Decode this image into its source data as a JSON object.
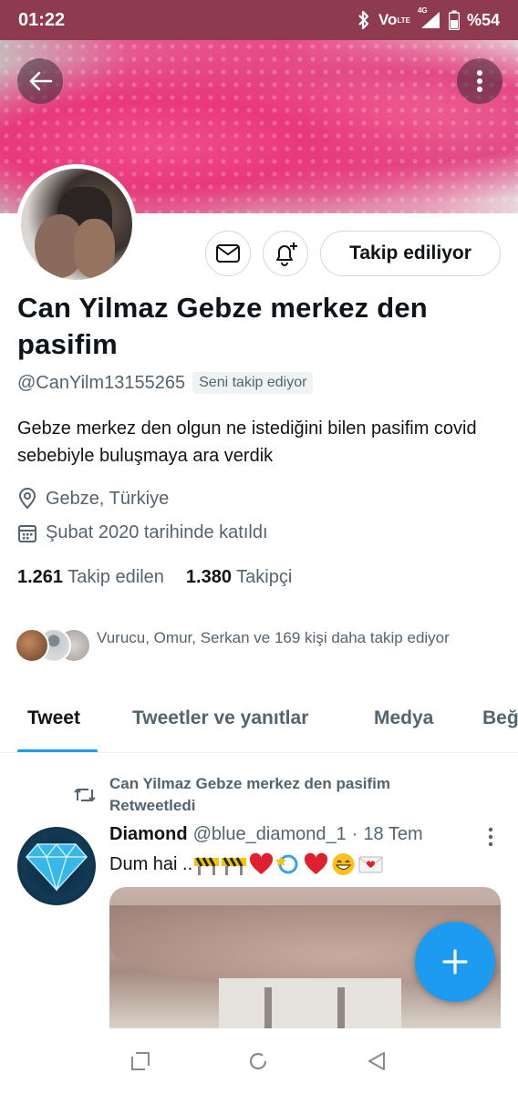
{
  "status_bar": {
    "time": "01:22",
    "network_label": "Vo",
    "network_sub": "LTE",
    "signal_label": "4G",
    "battery": "%54"
  },
  "profile": {
    "display_name": "Can Yilmaz Gebze merkez den pasifim",
    "handle": "@CanYilm13155265",
    "follows_you_badge": "Seni takip ediyor",
    "bio": "Gebze merkez den olgun ne istediğini bilen pasifim covid sebebiyle buluşmaya ara verdik",
    "location": "Gebze, Türkiye",
    "joined": "Şubat 2020 tarihinde katıldı",
    "following_count": "1.261",
    "following_label": "Takip edilen",
    "followers_count": "1.380",
    "followers_label": "Takipçi",
    "known_followers_text": "Vurucu, Omur, Serkan ve 169 kişi daha takip ediyor",
    "follow_button_label": "Takip ediliyor"
  },
  "tabs": [
    {
      "label": "Tweet",
      "active": true
    },
    {
      "label": "Tweetler ve yanıtlar",
      "active": false
    },
    {
      "label": "Medya",
      "active": false
    },
    {
      "label": "Beğ",
      "active": false
    }
  ],
  "tweet": {
    "retweet_line1": "Can Yilmaz Gebze merkez den pasifim",
    "retweet_line2": "Retweetledi",
    "author": "Diamond",
    "handle": "@blue_diamond_1",
    "separator": "·",
    "date": "18 Tem",
    "text": "Dum hai .."
  },
  "colors": {
    "accent": "#1d9bf0",
    "status_bar": "#8e3a4f",
    "secondary_text": "#536471"
  }
}
